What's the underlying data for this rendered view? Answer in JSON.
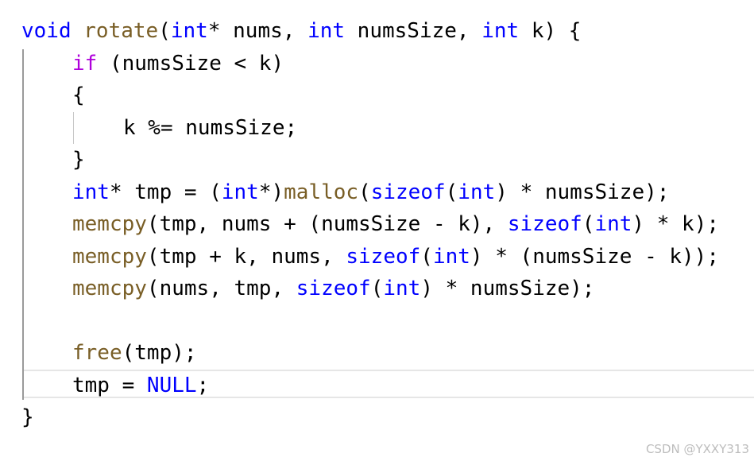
{
  "code": {
    "lines": [
      {
        "indent": 0,
        "tokens": [
          {
            "t": "void",
            "c": "kw"
          },
          {
            "t": " ",
            "c": "plain"
          },
          {
            "t": "rotate",
            "c": "fn"
          },
          {
            "t": "(",
            "c": "plain"
          },
          {
            "t": "int",
            "c": "kw"
          },
          {
            "t": "* nums, ",
            "c": "plain"
          },
          {
            "t": "int",
            "c": "kw"
          },
          {
            "t": " numsSize, ",
            "c": "plain"
          },
          {
            "t": "int",
            "c": "kw"
          },
          {
            "t": " k) {",
            "c": "plain"
          }
        ]
      },
      {
        "indent": 1,
        "tokens": [
          {
            "t": "if",
            "c": "ctrl"
          },
          {
            "t": " (numsSize < k)",
            "c": "plain"
          }
        ]
      },
      {
        "indent": 1,
        "tokens": [
          {
            "t": "{",
            "c": "plain"
          }
        ]
      },
      {
        "indent": 2,
        "tokens": [
          {
            "t": "k %= numsSize;",
            "c": "plain"
          }
        ]
      },
      {
        "indent": 1,
        "tokens": [
          {
            "t": "}",
            "c": "plain"
          }
        ]
      },
      {
        "indent": 1,
        "tokens": [
          {
            "t": "int",
            "c": "kw"
          },
          {
            "t": "* tmp = (",
            "c": "plain"
          },
          {
            "t": "int",
            "c": "kw"
          },
          {
            "t": "*)",
            "c": "plain"
          },
          {
            "t": "malloc",
            "c": "fn"
          },
          {
            "t": "(",
            "c": "plain"
          },
          {
            "t": "sizeof",
            "c": "kw"
          },
          {
            "t": "(",
            "c": "plain"
          },
          {
            "t": "int",
            "c": "kw"
          },
          {
            "t": ") * numsSize);",
            "c": "plain"
          }
        ]
      },
      {
        "indent": 1,
        "tokens": [
          {
            "t": "memcpy",
            "c": "fn"
          },
          {
            "t": "(tmp, nums + (numsSize - k), ",
            "c": "plain"
          },
          {
            "t": "sizeof",
            "c": "kw"
          },
          {
            "t": "(",
            "c": "plain"
          },
          {
            "t": "int",
            "c": "kw"
          },
          {
            "t": ") * k);",
            "c": "plain"
          }
        ]
      },
      {
        "indent": 1,
        "tokens": [
          {
            "t": "memcpy",
            "c": "fn"
          },
          {
            "t": "(tmp + k, nums, ",
            "c": "plain"
          },
          {
            "t": "sizeof",
            "c": "kw"
          },
          {
            "t": "(",
            "c": "plain"
          },
          {
            "t": "int",
            "c": "kw"
          },
          {
            "t": ") * (numsSize - k));",
            "c": "plain"
          }
        ]
      },
      {
        "indent": 1,
        "tokens": [
          {
            "t": "memcpy",
            "c": "fn"
          },
          {
            "t": "(nums, tmp, ",
            "c": "plain"
          },
          {
            "t": "sizeof",
            "c": "kw"
          },
          {
            "t": "(",
            "c": "plain"
          },
          {
            "t": "int",
            "c": "kw"
          },
          {
            "t": ") * numsSize);",
            "c": "plain"
          }
        ]
      },
      {
        "indent": 0,
        "tokens": []
      },
      {
        "indent": 1,
        "tokens": [
          {
            "t": "free",
            "c": "fn"
          },
          {
            "t": "(tmp);",
            "c": "plain"
          }
        ]
      },
      {
        "indent": 1,
        "tokens": [
          {
            "t": "tmp = ",
            "c": "plain"
          },
          {
            "t": "NULL",
            "c": "kw"
          },
          {
            "t": ";",
            "c": "plain"
          }
        ]
      },
      {
        "indent": 0,
        "tokens": [
          {
            "t": "}",
            "c": "plain"
          }
        ]
      }
    ]
  },
  "colors": {
    "keyword": "#0000ff",
    "function": "#795e26",
    "control": "#af00db",
    "plain": "#000000"
  },
  "watermark": "CSDN @YXXY313"
}
